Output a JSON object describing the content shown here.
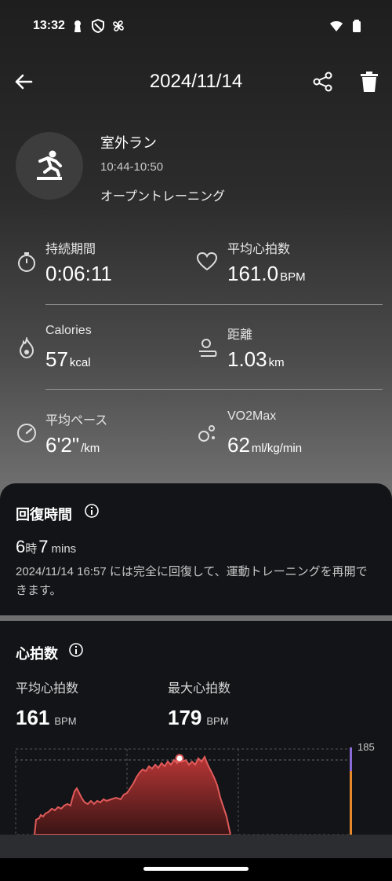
{
  "status_bar": {
    "time": "13:32"
  },
  "header": {
    "title": "2024/11/14"
  },
  "activity": {
    "name": "室外ラン",
    "time_range": "10:44-10:50",
    "type": "オープントレーニング"
  },
  "metrics": [
    {
      "label": "持続期間",
      "value": "0:06:11",
      "unit": "",
      "icon": "stopwatch-icon"
    },
    {
      "label": "平均心拍数",
      "value": "161.0",
      "unit": "BPM",
      "icon": "heart-icon"
    },
    {
      "label": "Calories",
      "value": "57",
      "unit": "kcal",
      "icon": "flame-icon"
    },
    {
      "label": "距離",
      "value": "1.03",
      "unit": "km",
      "icon": "distance-icon"
    },
    {
      "label": "平均ペース",
      "value": "6'2\"",
      "unit": "/km",
      "icon": "speedometer-icon"
    },
    {
      "label": "VO2Max",
      "value": "62",
      "unit": "ml/kg/min",
      "icon": "bubbles-icon"
    }
  ],
  "recovery": {
    "title": "回復時間",
    "hours": "6",
    "hours_unit": "時",
    "minutes": "7",
    "minutes_unit": "mins",
    "description": "2024/11/14 16:57 には完全に回復して、運動トレーニングを再開できます。"
  },
  "heart_rate": {
    "title": "心拍数",
    "avg_label": "平均心拍数",
    "avg_value": "161",
    "avg_unit": "BPM",
    "max_label": "最大心拍数",
    "max_value": "179",
    "max_unit": "BPM",
    "chart_max_label": "185"
  },
  "colors": {
    "chart_line": "#e05a5a",
    "chart_fill": "#7a2020",
    "card_bg": "#121417",
    "zone_orange": "#e6892a",
    "zone_purple": "#8a6bd6"
  }
}
